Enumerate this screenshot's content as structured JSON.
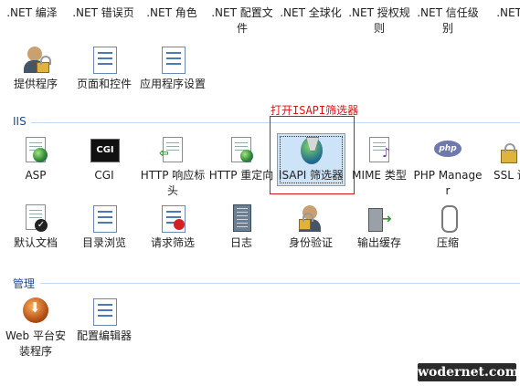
{
  "top_row": [
    {
      "label": ".NET 编泽"
    },
    {
      "label": ".NET 错误页"
    },
    {
      "label": ".NET 角色"
    },
    {
      "label": ".NET 配置文件"
    },
    {
      "label": ".NET 全球化"
    },
    {
      "label": ".NET 授权规则"
    },
    {
      "label": ".NET 信任级别"
    },
    {
      "label": ".NET 胍"
    }
  ],
  "aspnet_row2": [
    {
      "label": "提供程序",
      "icon": "provider-person-icon"
    },
    {
      "label": "页面和控件",
      "icon": "pages-controls-icon"
    },
    {
      "label": "应用程序设置",
      "icon": "app-settings-icon"
    }
  ],
  "iis_section": {
    "title": "IIS",
    "row1": [
      {
        "label": "ASP",
        "icon": "asp-icon"
      },
      {
        "label": "CGI",
        "icon": "cgi-icon",
        "icon_text": "CGI"
      },
      {
        "label": "HTTP 响应标头",
        "icon": "http-response-headers-icon"
      },
      {
        "label": "HTTP 重定向",
        "icon": "http-redirect-icon"
      },
      {
        "label": "ISAPI 筛选器",
        "icon": "isapi-filters-icon",
        "selected": true
      },
      {
        "label": "MIME 类型",
        "icon": "mime-types-icon"
      },
      {
        "label": "PHP Manager",
        "icon": "php-manager-icon",
        "icon_text": "php"
      },
      {
        "label": "SSL 设",
        "icon": "ssl-settings-icon"
      }
    ],
    "row2": [
      {
        "label": "默认文档",
        "icon": "default-document-icon"
      },
      {
        "label": "目录浏览",
        "icon": "directory-browsing-icon"
      },
      {
        "label": "请求筛选",
        "icon": "request-filtering-icon"
      },
      {
        "label": "日志",
        "icon": "logging-icon"
      },
      {
        "label": "身份验证",
        "icon": "authentication-icon"
      },
      {
        "label": "输出缓存",
        "icon": "output-caching-icon"
      },
      {
        "label": "压缩",
        "icon": "compression-icon"
      }
    ]
  },
  "management_section": {
    "title": "管理",
    "items": [
      {
        "label": "Web 平台安装程序",
        "icon": "web-platform-installer-icon"
      },
      {
        "label": "配置编辑器",
        "icon": "configuration-editor-icon"
      }
    ]
  },
  "annotation": {
    "text": "打开ISAPI筛选器",
    "color": "#d81414"
  },
  "watermark": {
    "text": "wodernet.com"
  },
  "colors": {
    "section_header": "#1e4b8f",
    "selection_bg": "#cde3f7"
  }
}
